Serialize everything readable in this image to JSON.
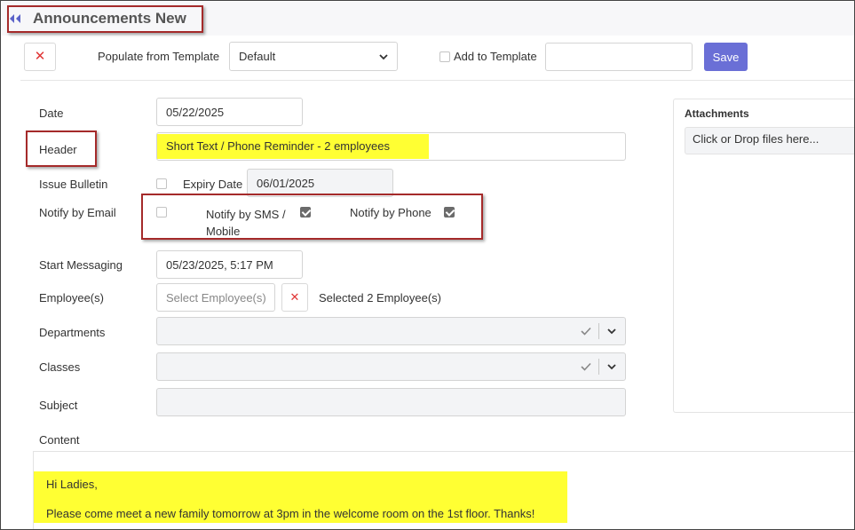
{
  "page": {
    "title": "Announcements New"
  },
  "toolbar": {
    "template_label": "Populate from Template",
    "template_value": "Default",
    "add_to_template_label": "Add to Template",
    "template_name_value": "",
    "save_label": "Save"
  },
  "form": {
    "date_label": "Date",
    "date_value": "05/22/2025",
    "header_label": "Header",
    "header_value": "Short Text / Phone Reminder - 2 employees",
    "issue_bulletin_label": "Issue Bulletin",
    "issue_bulletin_checked": false,
    "expiry_label": "Expiry Date",
    "expiry_value": "06/01/2025",
    "notify_email_label": "Notify by Email",
    "notify_email_checked": false,
    "notify_sms_label_line1": "Notify by SMS /",
    "notify_sms_label_line2": "Mobile",
    "notify_sms_checked": true,
    "notify_phone_label": "Notify by Phone",
    "notify_phone_checked": true,
    "start_label": "Start Messaging",
    "start_value": "05/23/2025, 5:17 PM",
    "employees_label": "Employee(s)",
    "employees_placeholder": "Select Employee(s)",
    "employees_selected": "Selected 2 Employee(s)",
    "departments_label": "Departments",
    "classes_label": "Classes",
    "subject_label": "Subject",
    "subject_value": "",
    "content_label": "Content"
  },
  "attachments": {
    "title": "Attachments",
    "dropzone_text": "Click or Drop files here..."
  },
  "content": {
    "line1": "Hi Ladies,",
    "line2": "Please come meet a new family tomorrow at 3pm in the welcome room on the 1st floor. Thanks!"
  },
  "colors": {
    "accent": "#6a6fd6",
    "highlight": "#ffff33",
    "annotation_box": "#a52a2a",
    "danger": "#e03535"
  }
}
